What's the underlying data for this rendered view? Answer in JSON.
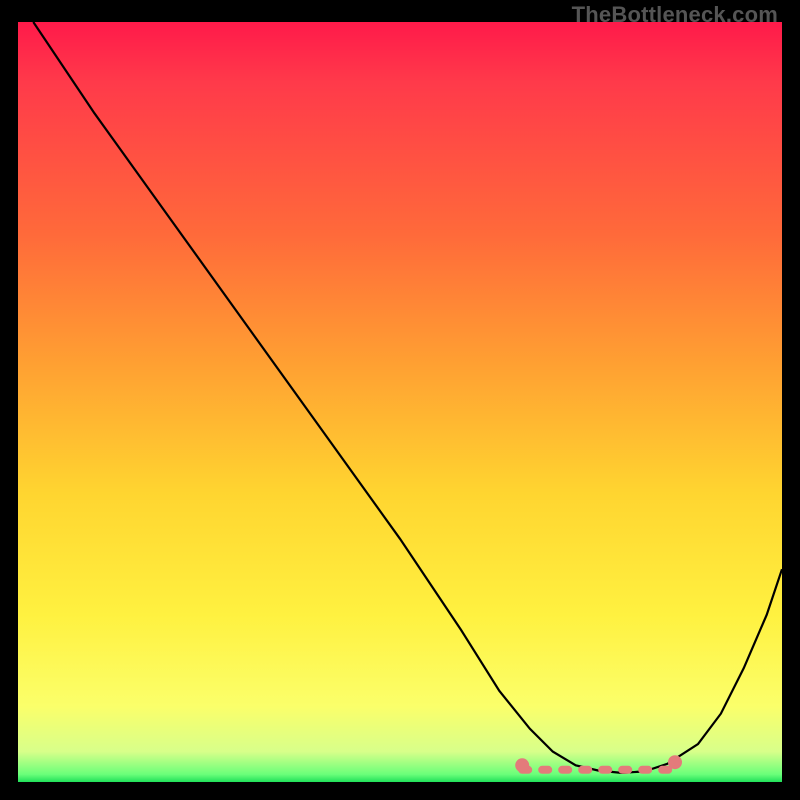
{
  "watermark": "TheBottleneck.com",
  "chart_data": {
    "type": "line",
    "title": "",
    "xlabel": "",
    "ylabel": "",
    "xlim": [
      0,
      100
    ],
    "ylim": [
      0,
      100
    ],
    "grid": false,
    "series": [
      {
        "name": "curve",
        "x": [
          2,
          10,
          20,
          30,
          40,
          50,
          58,
          63,
          67,
          70,
          73,
          76,
          79,
          82,
          85,
          89,
          92,
          95,
          98,
          100
        ],
        "y": [
          100,
          88,
          74,
          60,
          46,
          32,
          20,
          12,
          7,
          4,
          2.2,
          1.5,
          1.2,
          1.4,
          2.4,
          5,
          9,
          15,
          22,
          28
        ]
      }
    ],
    "annotations": {
      "flat_region_dots": {
        "x_start": 66,
        "x_end": 86,
        "y": 1.6,
        "end_markers": [
          {
            "x": 66,
            "y": 2.2
          },
          {
            "x": 86,
            "y": 2.6
          }
        ]
      }
    }
  }
}
